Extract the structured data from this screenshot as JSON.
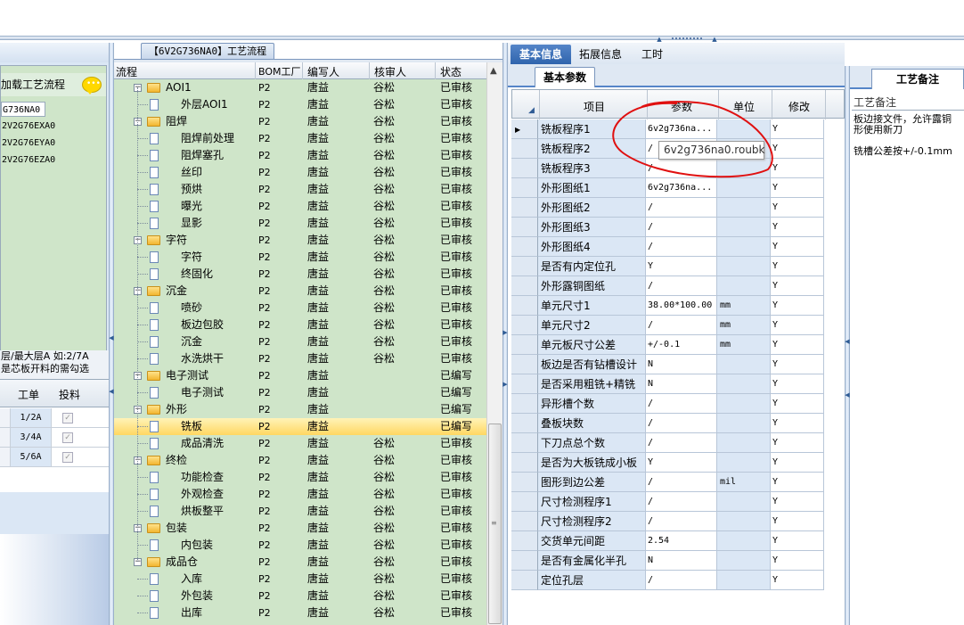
{
  "left_panel": {
    "load_label": "加载工艺流程",
    "codes": [
      "G736NA0",
      "2V2G76EXA0",
      "2V2G76EYA0",
      "2V2G76EZA0"
    ],
    "note_line1": "层/最大层A 如:2/7A",
    "note_line2": "是芯板开料的需勾选",
    "grid_headers": [
      "工单",
      "投料"
    ],
    "grid_rows": [
      {
        "order": "1/2A",
        "checked": "✓"
      },
      {
        "order": "3/4A",
        "checked": "✓"
      },
      {
        "order": "5/6A",
        "checked": "✓"
      }
    ]
  },
  "mid_panel": {
    "tab": "【6V2G736NA0】工艺流程",
    "headers": {
      "flow": "流程",
      "bom": "BOM工厂",
      "writer": "编写人",
      "reviewer": "核审人",
      "status": "状态"
    },
    "rows": [
      {
        "name": "AOI1",
        "level": 0,
        "bom": "P2",
        "writer": "唐益",
        "reviewer": "谷松",
        "status": "已审核"
      },
      {
        "name": "外层AOI1",
        "level": 1,
        "bom": "P2",
        "writer": "唐益",
        "reviewer": "谷松",
        "status": "已审核"
      },
      {
        "name": "阻焊",
        "level": 0,
        "bom": "P2",
        "writer": "唐益",
        "reviewer": "谷松",
        "status": "已审核"
      },
      {
        "name": "阻焊前处理",
        "level": 1,
        "bom": "P2",
        "writer": "唐益",
        "reviewer": "谷松",
        "status": "已审核"
      },
      {
        "name": "阻焊塞孔",
        "level": 1,
        "bom": "P2",
        "writer": "唐益",
        "reviewer": "谷松",
        "status": "已审核"
      },
      {
        "name": "丝印",
        "level": 1,
        "bom": "P2",
        "writer": "唐益",
        "reviewer": "谷松",
        "status": "已审核"
      },
      {
        "name": "预烘",
        "level": 1,
        "bom": "P2",
        "writer": "唐益",
        "reviewer": "谷松",
        "status": "已审核"
      },
      {
        "name": "曝光",
        "level": 1,
        "bom": "P2",
        "writer": "唐益",
        "reviewer": "谷松",
        "status": "已审核"
      },
      {
        "name": "显影",
        "level": 1,
        "bom": "P2",
        "writer": "唐益",
        "reviewer": "谷松",
        "status": "已审核"
      },
      {
        "name": "字符",
        "level": 0,
        "bom": "P2",
        "writer": "唐益",
        "reviewer": "谷松",
        "status": "已审核"
      },
      {
        "name": "字符",
        "level": 1,
        "bom": "P2",
        "writer": "唐益",
        "reviewer": "谷松",
        "status": "已审核"
      },
      {
        "name": "终固化",
        "level": 1,
        "bom": "P2",
        "writer": "唐益",
        "reviewer": "谷松",
        "status": "已审核"
      },
      {
        "name": "沉金",
        "level": 0,
        "bom": "P2",
        "writer": "唐益",
        "reviewer": "谷松",
        "status": "已审核"
      },
      {
        "name": "喷砂",
        "level": 1,
        "bom": "P2",
        "writer": "唐益",
        "reviewer": "谷松",
        "status": "已审核"
      },
      {
        "name": "板边包胶",
        "level": 1,
        "bom": "P2",
        "writer": "唐益",
        "reviewer": "谷松",
        "status": "已审核"
      },
      {
        "name": "沉金",
        "level": 1,
        "bom": "P2",
        "writer": "唐益",
        "reviewer": "谷松",
        "status": "已审核"
      },
      {
        "name": "水洗烘干",
        "level": 1,
        "bom": "P2",
        "writer": "唐益",
        "reviewer": "谷松",
        "status": "已审核"
      },
      {
        "name": "电子测试",
        "level": 0,
        "bom": "P2",
        "writer": "唐益",
        "reviewer": "",
        "status": "已编写"
      },
      {
        "name": "电子测试",
        "level": 1,
        "bom": "P2",
        "writer": "唐益",
        "reviewer": "",
        "status": "已编写"
      },
      {
        "name": "外形",
        "level": 0,
        "bom": "P2",
        "writer": "唐益",
        "reviewer": "",
        "status": "已编写"
      },
      {
        "name": "铣板",
        "level": 1,
        "bom": "P2",
        "writer": "唐益",
        "reviewer": "",
        "status": "已编写",
        "selected": true
      },
      {
        "name": "成品清洗",
        "level": 1,
        "bom": "P2",
        "writer": "唐益",
        "reviewer": "谷松",
        "status": "已审核"
      },
      {
        "name": "终检",
        "level": 0,
        "bom": "P2",
        "writer": "唐益",
        "reviewer": "谷松",
        "status": "已审核"
      },
      {
        "name": "功能检查",
        "level": 1,
        "bom": "P2",
        "writer": "唐益",
        "reviewer": "谷松",
        "status": "已审核"
      },
      {
        "name": "外观检查",
        "level": 1,
        "bom": "P2",
        "writer": "唐益",
        "reviewer": "谷松",
        "status": "已审核"
      },
      {
        "name": "烘板整平",
        "level": 1,
        "bom": "P2",
        "writer": "唐益",
        "reviewer": "谷松",
        "status": "已审核"
      },
      {
        "name": "包装",
        "level": 0,
        "bom": "P2",
        "writer": "唐益",
        "reviewer": "谷松",
        "status": "已审核"
      },
      {
        "name": "内包装",
        "level": 1,
        "bom": "P2",
        "writer": "唐益",
        "reviewer": "谷松",
        "status": "已审核"
      },
      {
        "name": "成品仓",
        "level": 0,
        "bom": "P2",
        "writer": "唐益",
        "reviewer": "谷松",
        "status": "已审核"
      },
      {
        "name": "入库",
        "level": 1,
        "bom": "P2",
        "writer": "唐益",
        "reviewer": "谷松",
        "status": "已审核"
      },
      {
        "name": "外包装",
        "level": 1,
        "bom": "P2",
        "writer": "唐益",
        "reviewer": "谷松",
        "status": "已审核"
      },
      {
        "name": "出库",
        "level": 1,
        "bom": "P2",
        "writer": "唐益",
        "reviewer": "谷松",
        "status": "已审核"
      }
    ]
  },
  "right_panel": {
    "tabs": [
      "基本信息",
      "拓展信息",
      "工时"
    ],
    "subtab": "基本参数",
    "headers": {
      "item": "项目",
      "param": "参数",
      "unit": "单位",
      "modify": "修改"
    },
    "tooltip": "6v2g736na0.roubk",
    "rows": [
      {
        "item": "铣板程序1",
        "value": "6v2g736na...",
        "unit": "",
        "modify": "Y"
      },
      {
        "item": "铣板程序2",
        "value": "/",
        "unit": "",
        "modify": "Y"
      },
      {
        "item": "铣板程序3",
        "value": "/",
        "unit": "",
        "modify": "Y"
      },
      {
        "item": "外形图纸1",
        "value": "6v2g736na...",
        "unit": "",
        "modify": "Y"
      },
      {
        "item": "外形图纸2",
        "value": "/",
        "unit": "",
        "modify": "Y"
      },
      {
        "item": "外形图纸3",
        "value": "/",
        "unit": "",
        "modify": "Y"
      },
      {
        "item": "外形图纸4",
        "value": "/",
        "unit": "",
        "modify": "Y"
      },
      {
        "item": "是否有内定位孔",
        "value": "Y",
        "unit": "",
        "modify": "Y"
      },
      {
        "item": "外形露铜图纸",
        "value": "/",
        "unit": "",
        "modify": "Y"
      },
      {
        "item": "单元尺寸1",
        "value": "38.00*100.00",
        "unit": "mm",
        "modify": "Y"
      },
      {
        "item": "单元尺寸2",
        "value": "/",
        "unit": "mm",
        "modify": "Y"
      },
      {
        "item": "单元板尺寸公差",
        "value": "+/-0.1",
        "unit": "mm",
        "modify": "Y"
      },
      {
        "item": "板边是否有钻槽设计",
        "value": "N",
        "unit": "",
        "modify": "Y"
      },
      {
        "item": "是否采用粗铣+精铣",
        "value": "N",
        "unit": "",
        "modify": "Y"
      },
      {
        "item": "异形槽个数",
        "value": "/",
        "unit": "",
        "modify": "Y"
      },
      {
        "item": "叠板块数",
        "value": "/",
        "unit": "",
        "modify": "Y"
      },
      {
        "item": "下刀点总个数",
        "value": "/",
        "unit": "",
        "modify": "Y"
      },
      {
        "item": "是否为大板铣成小板",
        "value": "Y",
        "unit": "",
        "modify": "Y"
      },
      {
        "item": "图形到边公差",
        "value": "/",
        "unit": "mil",
        "modify": "Y"
      },
      {
        "item": "尺寸检测程序1",
        "value": "/",
        "unit": "",
        "modify": "Y"
      },
      {
        "item": "尺寸检测程序2",
        "value": "/",
        "unit": "",
        "modify": "Y"
      },
      {
        "item": "交货单元间距",
        "value": "2.54",
        "unit": "",
        "modify": "Y"
      },
      {
        "item": "是否有金属化半孔",
        "value": "N",
        "unit": "",
        "modify": "Y"
      },
      {
        "item": "定位孔层",
        "value": "/",
        "unit": "",
        "modify": "Y"
      }
    ]
  },
  "far_panel": {
    "tab": "工艺备注",
    "label": "工艺备注",
    "text_line1": "板边接文件，允许露铜",
    "text_line2": "形使用新刀",
    "text_line3": "铣槽公差按+/-0.1mm"
  }
}
